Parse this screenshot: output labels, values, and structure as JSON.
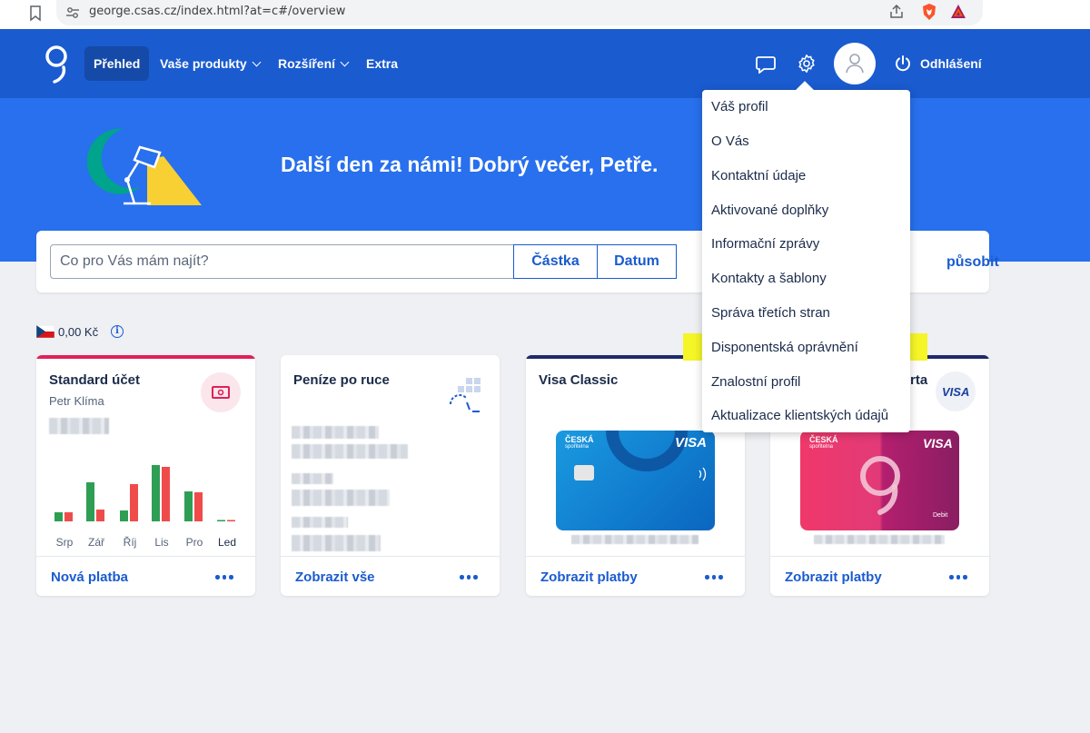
{
  "browser": {
    "url": "george.csas.cz/index.html?at=c#/overview"
  },
  "nav": {
    "items": [
      {
        "label": "Přehled",
        "active": true
      },
      {
        "label": "Vaše produkty",
        "dropdown": true
      },
      {
        "label": "Rozšíření",
        "dropdown": true
      },
      {
        "label": "Extra",
        "dropdown": false
      }
    ],
    "logout_label": "Odhlášení"
  },
  "hero": {
    "greeting": "Další den za námi! Dobrý večer, Petře."
  },
  "search": {
    "placeholder": "Co pro Vás mám najít?",
    "filters": [
      "Částka",
      "Datum"
    ],
    "customize_label": "působit"
  },
  "balance": {
    "amount": "0,00 Kč"
  },
  "cards": [
    {
      "title": "Standard účet",
      "owner": "Petr Klíma",
      "action": "Nová platba",
      "stripe": "#e0205a"
    },
    {
      "title": "Peníze po ruce",
      "action": "Zobrazit vše",
      "stripe": "#ffffff"
    },
    {
      "title": "Visa Classic",
      "action": "Zobrazit platby",
      "stripe": "#1f2a6b",
      "card_brand": "VISA"
    },
    {
      "title": "rta",
      "action": "Zobrazit platby",
      "stripe": "#1f2a6b",
      "card_brand": "VISA",
      "badge": "VISA",
      "card_note": "Debit"
    }
  ],
  "bank_card": {
    "brand_line1": "ČESKÁ",
    "brand_line2": "spořitelna"
  },
  "chart_data": {
    "type": "bar",
    "categories": [
      "Srp",
      "Zář",
      "Říj",
      "Lis",
      "Pro",
      "Led"
    ],
    "series": [
      {
        "values": [
          10,
          43,
          12,
          62,
          33,
          0.5
        ],
        "color": "#2e9e54"
      },
      {
        "values": [
          10,
          13,
          41,
          60,
          32,
          1.5
        ],
        "color": "#f04b4b"
      }
    ],
    "current_category": "Led"
  },
  "profile_menu": {
    "items": [
      "Váš profil",
      "O Vás",
      "Kontaktní údaje",
      "Aktivované doplňky",
      "Informační zprávy",
      "Kontakty a šablony",
      "Správa třetích stran",
      "Disponentská oprávnění",
      "Znalostní profil",
      "Aktualizace klientských údajů"
    ],
    "highlighted": "Disponentská oprávnění"
  },
  "colors": {
    "primary": "#1a5bcf",
    "hero": "#2870ed",
    "highlight": "#f5f528"
  }
}
